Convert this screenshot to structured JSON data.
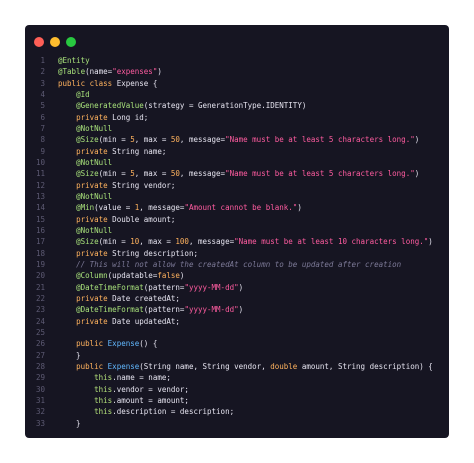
{
  "window": {
    "background": "#161522",
    "buttons": [
      {
        "name": "close",
        "color": "#ff5f57"
      },
      {
        "name": "minimize",
        "color": "#febc2e"
      },
      {
        "name": "maximize",
        "color": "#28c840"
      }
    ]
  },
  "palette": {
    "plain": "#e6e4f0",
    "annotation": "#a7e07a",
    "keyword": "#ffb25e",
    "string": "#ff5ca0",
    "number": "#ffb25e",
    "comment": "#7d7a98",
    "type": "#e6e4f0",
    "method": "#62b8ff",
    "this": "#b3e07a",
    "line_number": "#5d5a73"
  },
  "editor": {
    "lines": [
      {
        "n": "1",
        "tokens": [
          {
            "t": "@Entity",
            "c": "annotation"
          }
        ]
      },
      {
        "n": "2",
        "tokens": [
          {
            "t": "@Table",
            "c": "annotation"
          },
          {
            "t": "(name=",
            "c": "plain"
          },
          {
            "t": "\"expenses\"",
            "c": "string"
          },
          {
            "t": ")",
            "c": "plain"
          }
        ]
      },
      {
        "n": "3",
        "tokens": [
          {
            "t": "public",
            "c": "keyword"
          },
          {
            "t": " ",
            "c": "plain"
          },
          {
            "t": "class",
            "c": "keyword"
          },
          {
            "t": " Expense {",
            "c": "plain"
          }
        ]
      },
      {
        "n": "4",
        "tokens": [
          {
            "t": "    ",
            "c": "plain"
          },
          {
            "t": "@Id",
            "c": "annotation"
          }
        ]
      },
      {
        "n": "5",
        "tokens": [
          {
            "t": "    ",
            "c": "plain"
          },
          {
            "t": "@GeneratedValue",
            "c": "annotation"
          },
          {
            "t": "(strategy = GenerationType.IDENTITY)",
            "c": "plain"
          }
        ]
      },
      {
        "n": "6",
        "tokens": [
          {
            "t": "    ",
            "c": "plain"
          },
          {
            "t": "private",
            "c": "keyword"
          },
          {
            "t": " Long id;",
            "c": "plain"
          }
        ]
      },
      {
        "n": "7",
        "tokens": [
          {
            "t": "    ",
            "c": "plain"
          },
          {
            "t": "@NotNull",
            "c": "annotation"
          }
        ]
      },
      {
        "n": "8",
        "tokens": [
          {
            "t": "    ",
            "c": "plain"
          },
          {
            "t": "@Size",
            "c": "annotation"
          },
          {
            "t": "(min = ",
            "c": "plain"
          },
          {
            "t": "5",
            "c": "number"
          },
          {
            "t": ", max = ",
            "c": "plain"
          },
          {
            "t": "50",
            "c": "number"
          },
          {
            "t": ", message=",
            "c": "plain"
          },
          {
            "t": "\"Name must be at least 5 characters long.\"",
            "c": "string"
          },
          {
            "t": ")",
            "c": "plain"
          }
        ]
      },
      {
        "n": "9",
        "tokens": [
          {
            "t": "    ",
            "c": "plain"
          },
          {
            "t": "private",
            "c": "keyword"
          },
          {
            "t": " String name;",
            "c": "plain"
          }
        ]
      },
      {
        "n": "10",
        "tokens": [
          {
            "t": "    ",
            "c": "plain"
          },
          {
            "t": "@NotNull",
            "c": "annotation"
          }
        ]
      },
      {
        "n": "11",
        "tokens": [
          {
            "t": "    ",
            "c": "plain"
          },
          {
            "t": "@Size",
            "c": "annotation"
          },
          {
            "t": "(min = ",
            "c": "plain"
          },
          {
            "t": "5",
            "c": "number"
          },
          {
            "t": ", max = ",
            "c": "plain"
          },
          {
            "t": "50",
            "c": "number"
          },
          {
            "t": ", message=",
            "c": "plain"
          },
          {
            "t": "\"Name must be at least 5 characters long.\"",
            "c": "string"
          },
          {
            "t": ")",
            "c": "plain"
          }
        ]
      },
      {
        "n": "12",
        "tokens": [
          {
            "t": "    ",
            "c": "plain"
          },
          {
            "t": "private",
            "c": "keyword"
          },
          {
            "t": " String vendor;",
            "c": "plain"
          }
        ]
      },
      {
        "n": "13",
        "tokens": [
          {
            "t": "    ",
            "c": "plain"
          },
          {
            "t": "@NotNull",
            "c": "annotation"
          }
        ]
      },
      {
        "n": "14",
        "tokens": [
          {
            "t": "    ",
            "c": "plain"
          },
          {
            "t": "@Min",
            "c": "annotation"
          },
          {
            "t": "(value = ",
            "c": "plain"
          },
          {
            "t": "1",
            "c": "number"
          },
          {
            "t": ", message=",
            "c": "plain"
          },
          {
            "t": "\"Amount cannot be blank.\"",
            "c": "string"
          },
          {
            "t": ")",
            "c": "plain"
          }
        ]
      },
      {
        "n": "15",
        "tokens": [
          {
            "t": "    ",
            "c": "plain"
          },
          {
            "t": "private",
            "c": "keyword"
          },
          {
            "t": " Double amount;",
            "c": "plain"
          }
        ]
      },
      {
        "n": "16",
        "tokens": [
          {
            "t": "    ",
            "c": "plain"
          },
          {
            "t": "@NotNull",
            "c": "annotation"
          }
        ]
      },
      {
        "n": "17",
        "tokens": [
          {
            "t": "    ",
            "c": "plain"
          },
          {
            "t": "@Size",
            "c": "annotation"
          },
          {
            "t": "(min = ",
            "c": "plain"
          },
          {
            "t": "10",
            "c": "number"
          },
          {
            "t": ", max = ",
            "c": "plain"
          },
          {
            "t": "100",
            "c": "number"
          },
          {
            "t": ", message=",
            "c": "plain"
          },
          {
            "t": "\"Name must be at least 10 characters long.\"",
            "c": "string"
          },
          {
            "t": ")",
            "c": "plain"
          }
        ]
      },
      {
        "n": "18",
        "tokens": [
          {
            "t": "    ",
            "c": "plain"
          },
          {
            "t": "private",
            "c": "keyword"
          },
          {
            "t": " String description;",
            "c": "plain"
          }
        ]
      },
      {
        "n": "19",
        "tokens": [
          {
            "t": "    ",
            "c": "plain"
          },
          {
            "t": "// This will not allow the createdAt column to be updated after creation",
            "c": "comment"
          }
        ]
      },
      {
        "n": "20",
        "tokens": [
          {
            "t": "    ",
            "c": "plain"
          },
          {
            "t": "@Column",
            "c": "annotation"
          },
          {
            "t": "(updatable=",
            "c": "plain"
          },
          {
            "t": "false",
            "c": "keyword"
          },
          {
            "t": ")",
            "c": "plain"
          }
        ]
      },
      {
        "n": "21",
        "tokens": [
          {
            "t": "    ",
            "c": "plain"
          },
          {
            "t": "@DateTimeFormat",
            "c": "annotation"
          },
          {
            "t": "(pattern=",
            "c": "plain"
          },
          {
            "t": "\"yyyy-MM-dd\"",
            "c": "string"
          },
          {
            "t": ")",
            "c": "plain"
          }
        ]
      },
      {
        "n": "22",
        "tokens": [
          {
            "t": "    ",
            "c": "plain"
          },
          {
            "t": "private",
            "c": "keyword"
          },
          {
            "t": " Date createdAt;",
            "c": "plain"
          }
        ]
      },
      {
        "n": "23",
        "tokens": [
          {
            "t": "    ",
            "c": "plain"
          },
          {
            "t": "@DateTimeFormat",
            "c": "annotation"
          },
          {
            "t": "(pattern=",
            "c": "plain"
          },
          {
            "t": "\"yyyy-MM-dd\"",
            "c": "string"
          },
          {
            "t": ")",
            "c": "plain"
          }
        ]
      },
      {
        "n": "24",
        "tokens": [
          {
            "t": "    ",
            "c": "plain"
          },
          {
            "t": "private",
            "c": "keyword"
          },
          {
            "t": " Date updatedAt;",
            "c": "plain"
          }
        ]
      },
      {
        "n": "25",
        "tokens": []
      },
      {
        "n": "26",
        "tokens": [
          {
            "t": "    ",
            "c": "plain"
          },
          {
            "t": "public",
            "c": "keyword"
          },
          {
            "t": " ",
            "c": "plain"
          },
          {
            "t": "Expense",
            "c": "method"
          },
          {
            "t": "() {",
            "c": "plain"
          }
        ]
      },
      {
        "n": "27",
        "tokens": [
          {
            "t": "    }",
            "c": "plain"
          }
        ]
      },
      {
        "n": "28",
        "tokens": [
          {
            "t": "    ",
            "c": "plain"
          },
          {
            "t": "public",
            "c": "keyword"
          },
          {
            "t": " ",
            "c": "plain"
          },
          {
            "t": "Expense",
            "c": "method"
          },
          {
            "t": "(String name, String vendor, ",
            "c": "plain"
          },
          {
            "t": "double",
            "c": "keyword"
          },
          {
            "t": " amount, String description) {",
            "c": "plain"
          }
        ]
      },
      {
        "n": "29",
        "tokens": [
          {
            "t": "        ",
            "c": "plain"
          },
          {
            "t": "this",
            "c": "this"
          },
          {
            "t": ".name = name;",
            "c": "plain"
          }
        ]
      },
      {
        "n": "30",
        "tokens": [
          {
            "t": "        ",
            "c": "plain"
          },
          {
            "t": "this",
            "c": "this"
          },
          {
            "t": ".vendor = vendor;",
            "c": "plain"
          }
        ]
      },
      {
        "n": "31",
        "tokens": [
          {
            "t": "        ",
            "c": "plain"
          },
          {
            "t": "this",
            "c": "this"
          },
          {
            "t": ".amount = amount;",
            "c": "plain"
          }
        ]
      },
      {
        "n": "32",
        "tokens": [
          {
            "t": "        ",
            "c": "plain"
          },
          {
            "t": "this",
            "c": "this"
          },
          {
            "t": ".description = description;",
            "c": "plain"
          }
        ]
      },
      {
        "n": "33",
        "tokens": [
          {
            "t": "    }",
            "c": "plain"
          }
        ]
      }
    ]
  }
}
